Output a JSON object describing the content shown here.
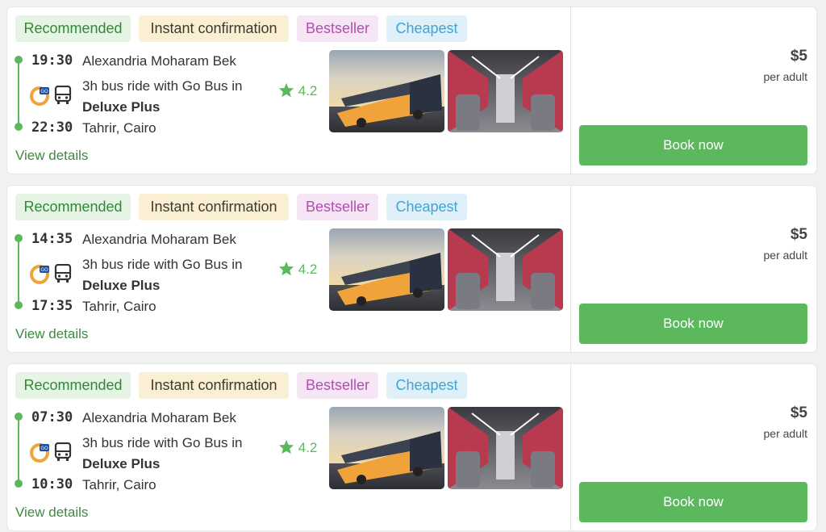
{
  "badges": {
    "recommended": "Recommended",
    "instant": "Instant confirmation",
    "bestseller": "Bestseller",
    "cheapest": "Cheapest"
  },
  "colors": {
    "accent_green": "#5cb85c",
    "link_green": "#3a8c3f",
    "operator_orange": "#f0a33a"
  },
  "icons": {
    "operator_logo": "go-bus-logo",
    "vehicle": "bus-icon",
    "rating": "star-icon"
  },
  "trips": [
    {
      "departure_time": "19:30",
      "departure_stop": "Alexandria Moharam Bek",
      "ride_text": "3h bus ride with Go Bus in",
      "class_name": "Deluxe Plus",
      "arrival_time": "22:30",
      "arrival_stop": "Tahrir, Cairo",
      "rating": "4.2",
      "view_details": "View details",
      "price": "$5",
      "price_unit": "per adult",
      "book_label": "Book now"
    },
    {
      "departure_time": "14:35",
      "departure_stop": "Alexandria Moharam Bek",
      "ride_text": "3h bus ride with Go Bus in",
      "class_name": "Deluxe Plus",
      "arrival_time": "17:35",
      "arrival_stop": "Tahrir, Cairo",
      "rating": "4.2",
      "view_details": "View details",
      "price": "$5",
      "price_unit": "per adult",
      "book_label": "Book now"
    },
    {
      "departure_time": "07:30",
      "departure_stop": "Alexandria Moharam Bek",
      "ride_text": "3h bus ride with Go Bus in",
      "class_name": "Deluxe Plus",
      "arrival_time": "10:30",
      "arrival_stop": "Tahrir, Cairo",
      "rating": "4.2",
      "view_details": "View details",
      "price": "$5",
      "price_unit": "per adult",
      "book_label": "Book now"
    }
  ]
}
